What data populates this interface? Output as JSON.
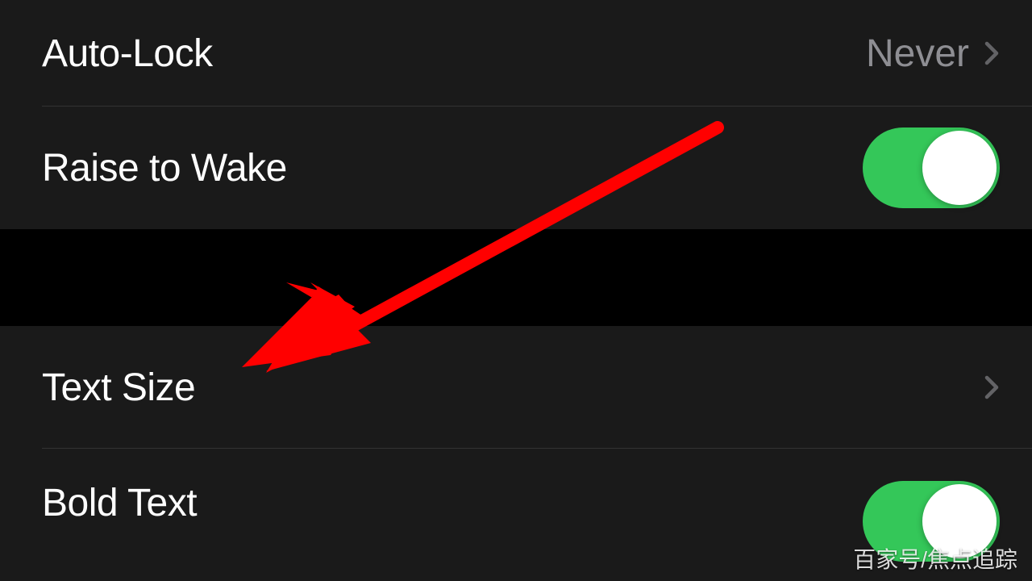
{
  "settings": {
    "group1": {
      "auto_lock": {
        "label": "Auto-Lock",
        "value": "Never"
      },
      "raise_to_wake": {
        "label": "Raise to Wake",
        "toggle_on": true
      }
    },
    "group2": {
      "text_size": {
        "label": "Text Size"
      },
      "bold_text": {
        "label": "Bold Text",
        "toggle_on": true
      }
    }
  },
  "watermark": "百家号/焦点追踪",
  "colors": {
    "toggle_on": "#34c759",
    "arrow": "#ff0000"
  }
}
